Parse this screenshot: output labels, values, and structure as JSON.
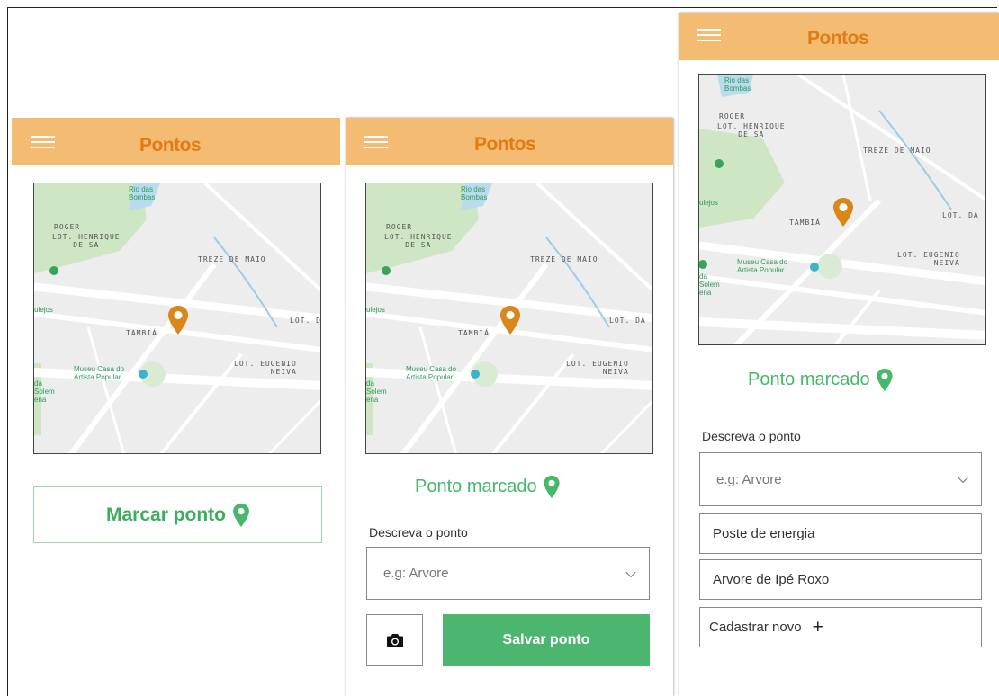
{
  "app": {
    "title": "Pontos"
  },
  "map_labels": {
    "river": "Rio das\nBombas",
    "roger": "ROGER",
    "lot_henrique": "LOT. HENRIQUE\n    DE SA",
    "treze": "TREZE DE MAIO",
    "tambia": "TAMBIÁ",
    "lot_da": "LOT. DA",
    "lot_eugenio": "LOT. EUGENIO\n       NEIVA",
    "museu": "Museu Casa do\nArtista Popular",
    "mejos": "ulejos",
    "solem": "da\nSolem\nena"
  },
  "screen1": {
    "mark_button": "Marcar ponto"
  },
  "screen2": {
    "status": "Ponto marcado",
    "describe_label": "Descreva o ponto",
    "select_placeholder": "e.g: Arvore",
    "save_button": "Salvar ponto"
  },
  "screen3": {
    "status": "Ponto marcado",
    "describe_label": "Descreva o ponto",
    "select_placeholder": "e.g: Arvore",
    "options": [
      "Poste de energia",
      "Arvore de Ipé Roxo"
    ],
    "add_new": "Cadastrar novo"
  },
  "colors": {
    "header": "#f4bc73",
    "title": "#e07c14",
    "pin": "#d9861b",
    "green": "#45b86a"
  }
}
